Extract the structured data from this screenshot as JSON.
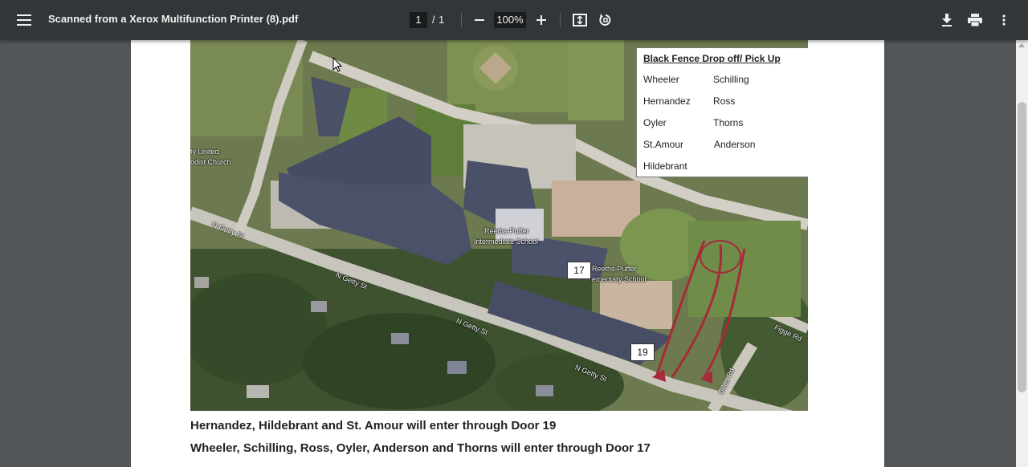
{
  "toolbar": {
    "title": "Scanned from a Xerox Multifunction Printer (8).pdf",
    "page_current": "1",
    "page_separator": "/",
    "page_total": "1",
    "zoom": "100%",
    "icons": [
      "menu-icon",
      "zoom-out-icon",
      "zoom-in-icon",
      "fit-page-icon",
      "rotate-icon",
      "download-icon",
      "print-icon",
      "more-vert-icon"
    ]
  },
  "legend": {
    "title": "Black Fence Drop off/ Pick Up",
    "left_column": [
      "Wheeler",
      "Hernandez",
      "Oyler",
      "St.Amour",
      "Hildebrant"
    ],
    "right_column": [
      "Schilling",
      "Ross",
      "Thorns",
      "Anderson"
    ]
  },
  "map": {
    "door_17": "17",
    "door_19": "19",
    "labels": {
      "church_1": "ty United",
      "church_2": "odist Church",
      "intermediate_1": "Reeths-Puffer",
      "intermediate_2": "Intermediate School",
      "elementary_1": "Reeths-Puffer",
      "elementary_2": "ementary School",
      "street_getty_1": "N Getty St",
      "street_getty_2": "N Getty St",
      "street_getty_3": "N Getty St",
      "street_getty_4": "N Getty St",
      "street_figge": "Figge Rd",
      "street_giles": "Giles Rd"
    }
  },
  "captions": {
    "line1": "Hernandez, Hildebrant and St. Amour will enter through Door 19",
    "line2": "Wheeler, Schilling, Ross, Oyler, Anderson and Thorns will enter through Door 17"
  },
  "colors": {
    "toolbar_bg": "#323639",
    "viewer_bg": "#525659",
    "caption_red": "#b0182a"
  }
}
